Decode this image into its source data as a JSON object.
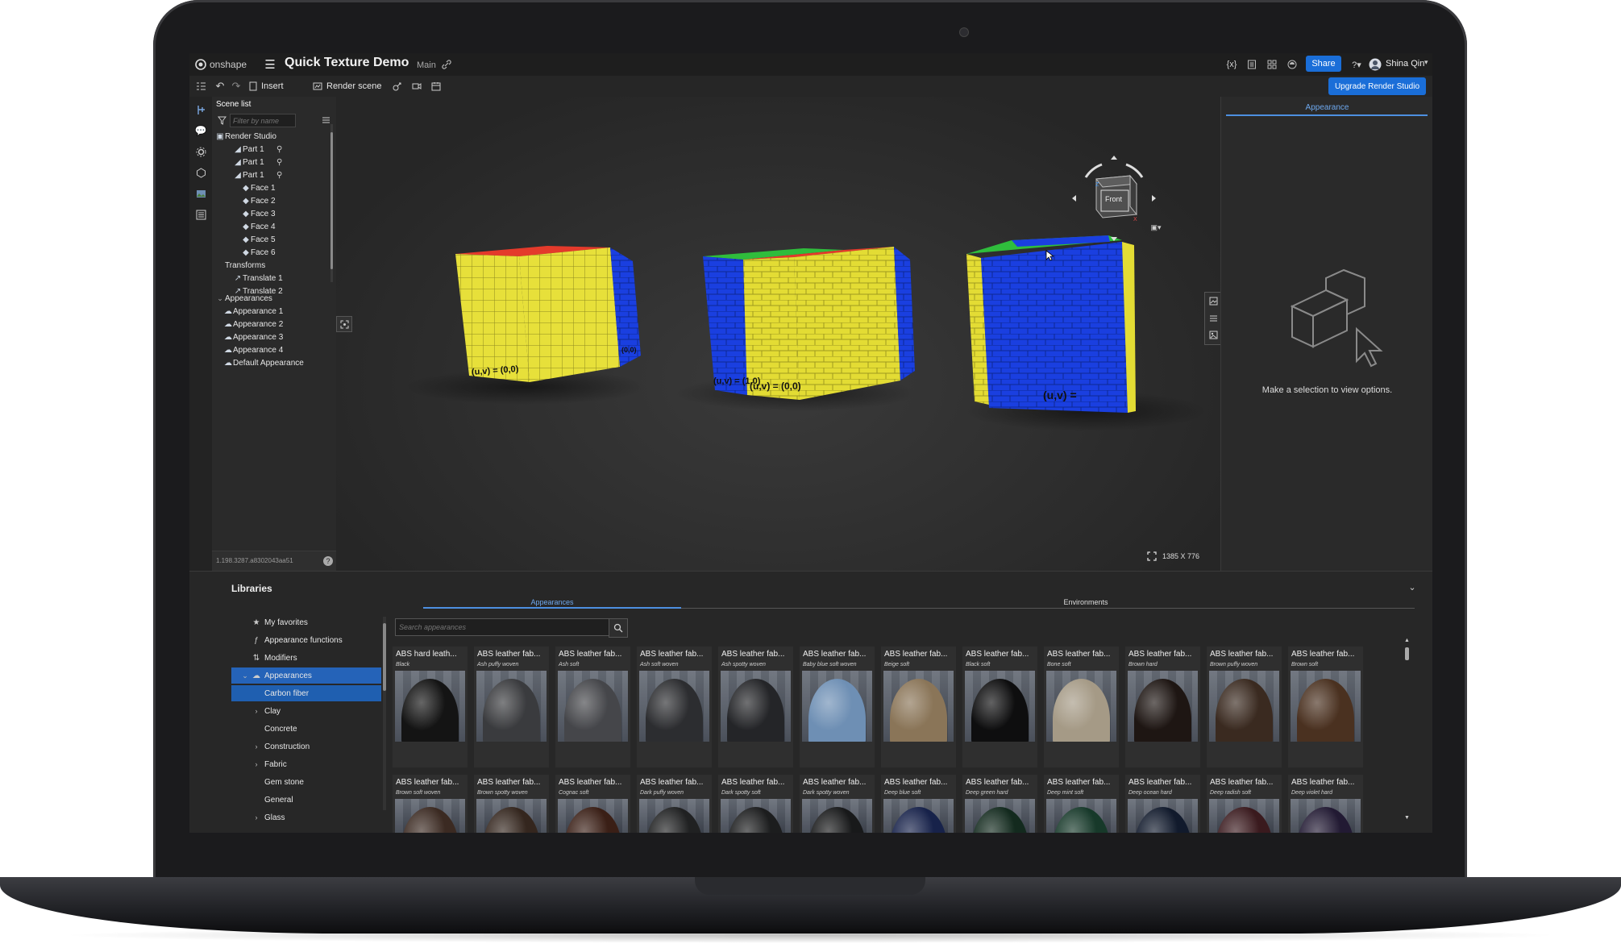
{
  "app": {
    "brand": "onshape",
    "doc_title": "Quick Texture Demo",
    "branch": "Main",
    "share_label": "Share",
    "user_name": "Shina Qin",
    "upgrade_label": "Upgrade Render Studio"
  },
  "toolbar": {
    "insert_label": "Insert",
    "render_label": "Render scene"
  },
  "scene": {
    "title": "Scene list",
    "filter_placeholder": "Filter by name",
    "root": "Render Studio",
    "items": [
      {
        "label": "Part 1",
        "level": 1,
        "chev": "›",
        "icon": "part"
      },
      {
        "label": "Part 1",
        "level": 1,
        "chev": "›",
        "icon": "part"
      },
      {
        "label": "Part 1",
        "level": 1,
        "chev": "⌄",
        "icon": "part"
      },
      {
        "label": "Face 1",
        "level": 2,
        "chev": "",
        "icon": "face"
      },
      {
        "label": "Face 2",
        "level": 2,
        "chev": "",
        "icon": "face"
      },
      {
        "label": "Face 3",
        "level": 2,
        "chev": "",
        "icon": "face"
      },
      {
        "label": "Face 4",
        "level": 2,
        "chev": "",
        "icon": "face"
      },
      {
        "label": "Face 5",
        "level": 2,
        "chev": "",
        "icon": "face"
      },
      {
        "label": "Face 6",
        "level": 2,
        "chev": "",
        "icon": "face"
      },
      {
        "label": "Transforms",
        "level": 0,
        "chev": "⌄",
        "icon": ""
      },
      {
        "label": "Translate 1",
        "level": 1,
        "chev": "",
        "icon": "transform"
      },
      {
        "label": "Translate 2",
        "level": 1,
        "chev": "",
        "icon": "transform"
      }
    ],
    "appearances_title": "Appearances",
    "appearances": [
      "Appearance 1",
      "Appearance 2",
      "Appearance 3",
      "Appearance 4",
      "Default Appearance"
    ],
    "version": "1.198.3287.a8302043aa51"
  },
  "viewport": {
    "view_cube_label": "Front",
    "axis_z": "Z",
    "axis_x": "X",
    "resolution": "1385 X 776",
    "uv_labels": [
      "(u,v) = (0,0)",
      "(0,0)",
      "(u,v) = (1,0)",
      "(u,v) = (0,0)",
      "(u,v) ="
    ]
  },
  "right": {
    "tab": "Appearance",
    "empty_msg": "Make a selection to view options."
  },
  "libraries": {
    "title": "Libraries",
    "tabs": [
      "Appearances",
      "Environments"
    ],
    "search_placeholder": "Search appearances",
    "tree": [
      {
        "label": "My favorites",
        "icon": "★",
        "indent": 0,
        "selected": false,
        "chev": ""
      },
      {
        "label": "Appearance functions",
        "icon": "ƒ",
        "indent": 0,
        "selected": false,
        "chev": ""
      },
      {
        "label": "Modifiers",
        "icon": "⇅",
        "indent": 0,
        "selected": false,
        "chev": ""
      },
      {
        "label": "Appearances",
        "icon": "☁",
        "indent": 0,
        "selected": true,
        "chev": "⌄"
      },
      {
        "label": "Carbon fiber",
        "icon": "",
        "indent": 1,
        "selected": true,
        "chev": ""
      },
      {
        "label": "Clay",
        "icon": "",
        "indent": 1,
        "selected": false,
        "chev": "›"
      },
      {
        "label": "Concrete",
        "icon": "",
        "indent": 1,
        "selected": false,
        "chev": ""
      },
      {
        "label": "Construction",
        "icon": "",
        "indent": 1,
        "selected": false,
        "chev": "›"
      },
      {
        "label": "Fabric",
        "icon": "",
        "indent": 1,
        "selected": false,
        "chev": "›"
      },
      {
        "label": "Gem stone",
        "icon": "",
        "indent": 1,
        "selected": false,
        "chev": ""
      },
      {
        "label": "General",
        "icon": "",
        "indent": 1,
        "selected": false,
        "chev": ""
      },
      {
        "label": "Glass",
        "icon": "",
        "indent": 1,
        "selected": false,
        "chev": "›"
      }
    ],
    "row1": [
      {
        "name": "ABS hard leath...",
        "sub": "Black",
        "color": "#141414"
      },
      {
        "name": "ABS leather fab...",
        "sub": "Ash puffy woven",
        "color": "#3a3b3e"
      },
      {
        "name": "ABS leather fab...",
        "sub": "Ash soft",
        "color": "#45464a"
      },
      {
        "name": "ABS leather fab...",
        "sub": "Ash soft woven",
        "color": "#2c2d30"
      },
      {
        "name": "ABS leather fab...",
        "sub": "Ash spotty woven",
        "color": "#242528"
      },
      {
        "name": "ABS leather fab...",
        "sub": "Baby blue soft woven",
        "color": "#6e8fb4"
      },
      {
        "name": "ABS leather fab...",
        "sub": "Beige soft",
        "color": "#8a7558"
      },
      {
        "name": "ABS leather fab...",
        "sub": "Black soft",
        "color": "#0e0e0f"
      },
      {
        "name": "ABS leather fab...",
        "sub": "Bone soft",
        "color": "#a59a86"
      },
      {
        "name": "ABS leather fab...",
        "sub": "Brown hard",
        "color": "#1e1613"
      },
      {
        "name": "ABS leather fab...",
        "sub": "Brown puffy woven",
        "color": "#3a2a20"
      },
      {
        "name": "ABS leather fab...",
        "sub": "Brown soft",
        "color": "#4a3120"
      }
    ],
    "row2": [
      {
        "name": "ABS leather fab...",
        "sub": "Brown soft woven",
        "color": "#3b2a22"
      },
      {
        "name": "ABS leather fab...",
        "sub": "Brown spotty woven",
        "color": "#34261e"
      },
      {
        "name": "ABS leather fab...",
        "sub": "Cognac soft",
        "color": "#3a1f16"
      },
      {
        "name": "ABS leather fab...",
        "sub": "Dark puffy woven",
        "color": "#202122"
      },
      {
        "name": "ABS leather fab...",
        "sub": "Dark spotty soft",
        "color": "#1c1d1e"
      },
      {
        "name": "ABS leather fab...",
        "sub": "Dark spotty woven",
        "color": "#18191a"
      },
      {
        "name": "ABS leather fab...",
        "sub": "Deep blue soft",
        "color": "#17224a"
      },
      {
        "name": "ABS leather fab...",
        "sub": "Deep green hard",
        "color": "#132a1e"
      },
      {
        "name": "ABS leather fab...",
        "sub": "Deep mint soft",
        "color": "#17392a"
      },
      {
        "name": "ABS leather fab...",
        "sub": "Deep ocean hard",
        "color": "#111a2c"
      },
      {
        "name": "ABS leather fab...",
        "sub": "Deep radish soft",
        "color": "#3a1a1e"
      },
      {
        "name": "ABS leather fab...",
        "sub": "Deep violet hard",
        "color": "#221a33"
      }
    ]
  }
}
